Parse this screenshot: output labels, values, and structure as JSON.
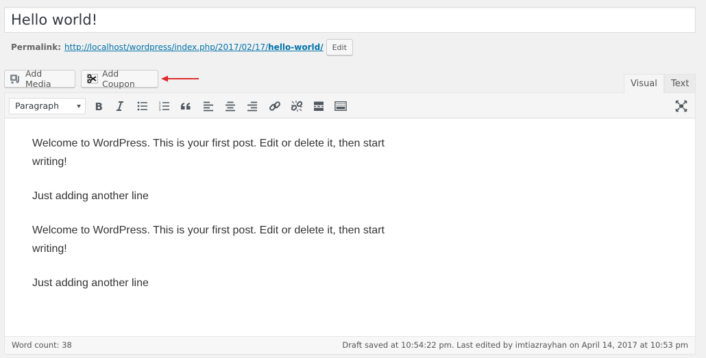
{
  "title": {
    "value": "Hello world!"
  },
  "permalink": {
    "label": "Permalink:",
    "url_base": "http://localhost/wordpress/index.php/2017/02/17/",
    "slug": "hello-world/",
    "edit_label": "Edit"
  },
  "media_buttons": {
    "add_media": {
      "label": "Add Media",
      "icon": "media-icon"
    },
    "add_coupon": {
      "label": "Add Coupon",
      "icon": "scissors-icon"
    }
  },
  "annotation": {
    "arrow_color": "#e02b2b",
    "icon": "arrow-left-icon"
  },
  "tabs": [
    {
      "label": "Visual",
      "active": true
    },
    {
      "label": "Text",
      "active": false
    }
  ],
  "toolbar": {
    "format_select": {
      "selected": "Paragraph"
    },
    "buttons": [
      {
        "name": "bold",
        "icon": "bold-icon"
      },
      {
        "name": "italic",
        "icon": "italic-icon"
      },
      {
        "name": "bulleted-list",
        "icon": "bulleted-list-icon"
      },
      {
        "name": "numbered-list",
        "icon": "numbered-list-icon"
      },
      {
        "name": "blockquote",
        "icon": "blockquote-icon"
      },
      {
        "name": "align-left",
        "icon": "align-left-icon"
      },
      {
        "name": "align-center",
        "icon": "align-center-icon"
      },
      {
        "name": "align-right",
        "icon": "align-right-icon"
      },
      {
        "name": "insert-link",
        "icon": "link-icon"
      },
      {
        "name": "remove-link",
        "icon": "unlink-icon"
      },
      {
        "name": "read-more",
        "icon": "read-more-icon"
      },
      {
        "name": "toolbar-toggle",
        "icon": "keyboard-icon"
      },
      {
        "name": "fullscreen",
        "icon": "fullscreen-icon"
      }
    ]
  },
  "content": {
    "paragraphs": [
      "Welcome to WordPress. This is your first post. Edit or delete it, then start writing!",
      "Just adding another line",
      "Welcome to WordPress. This is your first post. Edit or delete it, then start writing!",
      "Just adding another line"
    ]
  },
  "status": {
    "word_count": "Word count: 38",
    "draft_info": "Draft saved at 10:54:22 pm. Last edited by imtiazrayhan on April 14, 2017 at 10:53 pm"
  }
}
